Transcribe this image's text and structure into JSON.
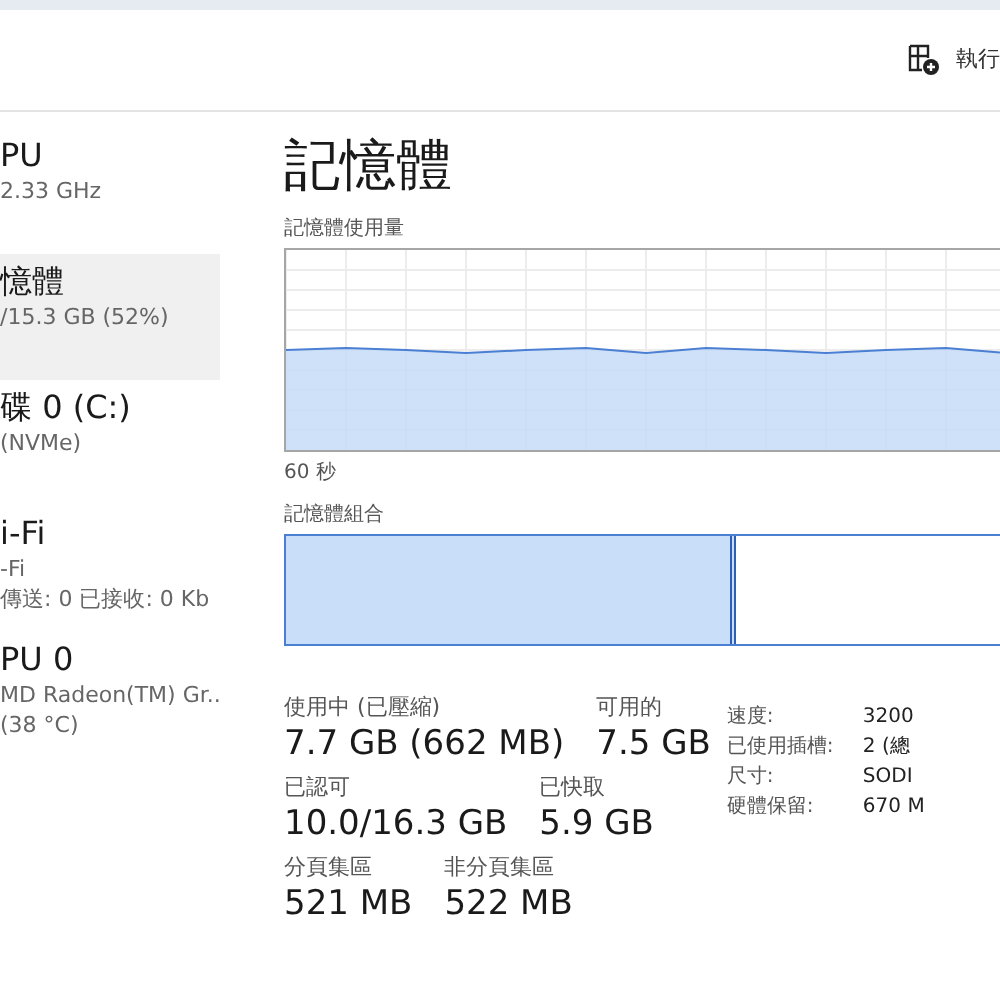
{
  "toolbar": {
    "run_label": "執行"
  },
  "sidebar": {
    "items": [
      {
        "title": "PU",
        "lines": [
          "2.33 GHz"
        ],
        "selected": false
      },
      {
        "title": "憶體",
        "lines": [
          "/15.3 GB (52%)"
        ],
        "selected": true
      },
      {
        "title": "碟 0 (C:)",
        "lines": [
          "(NVMe)"
        ],
        "selected": false
      },
      {
        "title": "i-Fi",
        "lines": [
          "-Fi",
          "傳送: 0 已接收: 0 Kb"
        ],
        "selected": false
      },
      {
        "title": "PU 0",
        "lines": [
          "MD Radeon(TM) Gr..",
          "(38 °C)"
        ],
        "selected": false
      }
    ]
  },
  "main": {
    "title": "記憶體",
    "usage_label": "記憶體使用量",
    "time_label": "60 秒",
    "composition_label": "記憶體組合",
    "composition": {
      "level": 0.63
    },
    "stats": [
      [
        {
          "label": "使用中 (已壓縮)",
          "value": "7.7 GB (662 MB)"
        },
        {
          "label": "可用的",
          "value": "7.5 GB"
        }
      ],
      [
        {
          "label": "已認可",
          "value": "10.0/16.3 GB"
        },
        {
          "label": "已快取",
          "value": "5.9 GB"
        }
      ],
      [
        {
          "label": "分頁集區",
          "value": "521 MB"
        },
        {
          "label": "非分頁集區",
          "value": "522 MB"
        }
      ]
    ],
    "details": [
      {
        "label": "速度:",
        "value": "3200"
      },
      {
        "label": "已使用插槽:",
        "value": "2 (總"
      },
      {
        "label": "尺寸:",
        "value": "SODI"
      },
      {
        "label": "硬體保留:",
        "value": "670 M"
      }
    ]
  }
}
